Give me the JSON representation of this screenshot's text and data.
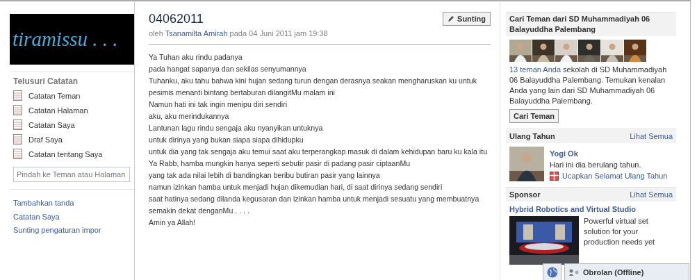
{
  "logo": {
    "text": "tiramissu . . ."
  },
  "sidebar": {
    "heading": "Telusuri Catatan",
    "items": [
      {
        "label": "Catatan Teman"
      },
      {
        "label": "Catatan Halaman"
      },
      {
        "label": "Catatan Saya"
      },
      {
        "label": "Draf Saya"
      },
      {
        "label": "Catatan tentang Saya"
      }
    ],
    "search": {
      "placeholder": "Pindah ke Teman atau Halaman"
    },
    "links": [
      "Tambahkan tanda",
      "Catatan Saya",
      "Sunting pengaturan impor"
    ]
  },
  "note": {
    "title": "04062011",
    "by_prefix": "oleh",
    "author": "Tsanamilta Amirah",
    "date": "pada 04 Juni 2011 jam 19:38",
    "edit_button": "Sunting",
    "lines": [
      "Ya Tuhan aku rindu padanya",
      "pada hangat sapanya dan sekilas senyumannya",
      "Tuhanku, aku tahu bahwa kini hujan sedang turun dengan derasnya seakan mengharuskan ku untuk",
      "pesimis menanti bintang bertaburan dilangitMu malam ini",
      "Namun hati ini tak ingin menipu diri sendiri",
      "aku, aku merindukannya",
      "Lantunan lagu rindu sengaja aku nyanyikan untuknya",
      "untuk dirinya yang bukan siapa siapa dihidupku",
      "untuk dia yang tak sengaja aku temui saat aku terperangkap masuk di dalam kehidupan baru ku kala itu",
      "Ya Rabb, hamba mungkin hanya seperti sebutir pasir di padang pasir ciptaanMu",
      "yang tak ada nilai lebih di bandingkan beribu butiran pasir yang lainnya",
      "namun izinkan hamba untuk menjadi hujan dikemudian hari, di saat dirinya sedang sendiri",
      "saat hatinya sedang dilanda kegusaran dan izinkan hamba untuk menjadi sesuatu yang membuatnya",
      "semakin dekat denganMu . . . .",
      "Amin ya Allah!"
    ]
  },
  "find_friends": {
    "title": "Cari Teman dari SD Muhammadiyah 06 Balayuddha Palembang",
    "link": "13 teman Anda",
    "text": "sekolah di SD Muhammadiyah 06 Balayuddha Palembang. Temukan kenalan Anda yang lain dari SD Muhammadiyah 06 Balayuddha Palembang.",
    "button": "Cari Teman"
  },
  "birthday": {
    "title": "Ulang Tahun",
    "see_all": "Lihat Semua",
    "name": "Yogi Ok",
    "text": "Hari ini dia berulang tahun.",
    "action": "Ucapkan Selamat Ulang Tahun"
  },
  "sponsor": {
    "title": "Sponsor",
    "see_all": "Lihat Semua",
    "ad_title": "Hybrid Robotics and Virtual Studio",
    "ad_text": "Powerful virtual set solution for your production needs yet"
  },
  "chat_bar": {
    "label": "Obrolan (Offline)"
  }
}
